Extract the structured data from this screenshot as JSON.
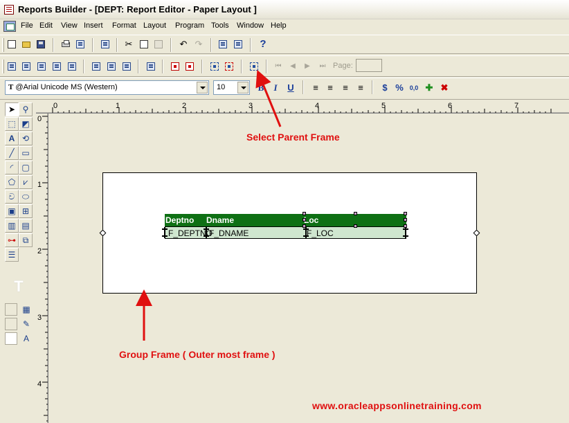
{
  "window": {
    "title": "Reports Builder - [DEPT: Report Editor - Paper Layout ]"
  },
  "menu": [
    "File",
    "Edit",
    "View",
    "Insert",
    "Format",
    "Layout",
    "Program",
    "Tools",
    "Window",
    "Help"
  ],
  "toolbar": {
    "page_label": "Page:",
    "page_value": ""
  },
  "format_bar": {
    "font": "@Arial Unicode MS (Western)",
    "size": "10",
    "bold": "B",
    "italic": "I",
    "underline": "U",
    "currency": "$",
    "percent": "%",
    "decimal": "0,0"
  },
  "ruler": {
    "top_numbers": [
      "0",
      "1",
      "2",
      "3",
      "4",
      "5",
      "6",
      "7"
    ],
    "left_numbers": [
      "0",
      "1",
      "2",
      "3",
      "4"
    ]
  },
  "layout": {
    "headers": [
      "Deptno",
      "Dname",
      "Loc"
    ],
    "fields": [
      "F_DEPTNO",
      "F_DNAME",
      "F_LOC"
    ]
  },
  "annotations": {
    "select_parent": "Select Parent Frame",
    "group_frame": "Group Frame ( Outer most frame )",
    "url": "www.oracleappsonlinetraining.com"
  },
  "colors": {
    "annotation": "#e01010",
    "header_fill": "#0e7014",
    "field_fill": "#cfe6cf"
  }
}
